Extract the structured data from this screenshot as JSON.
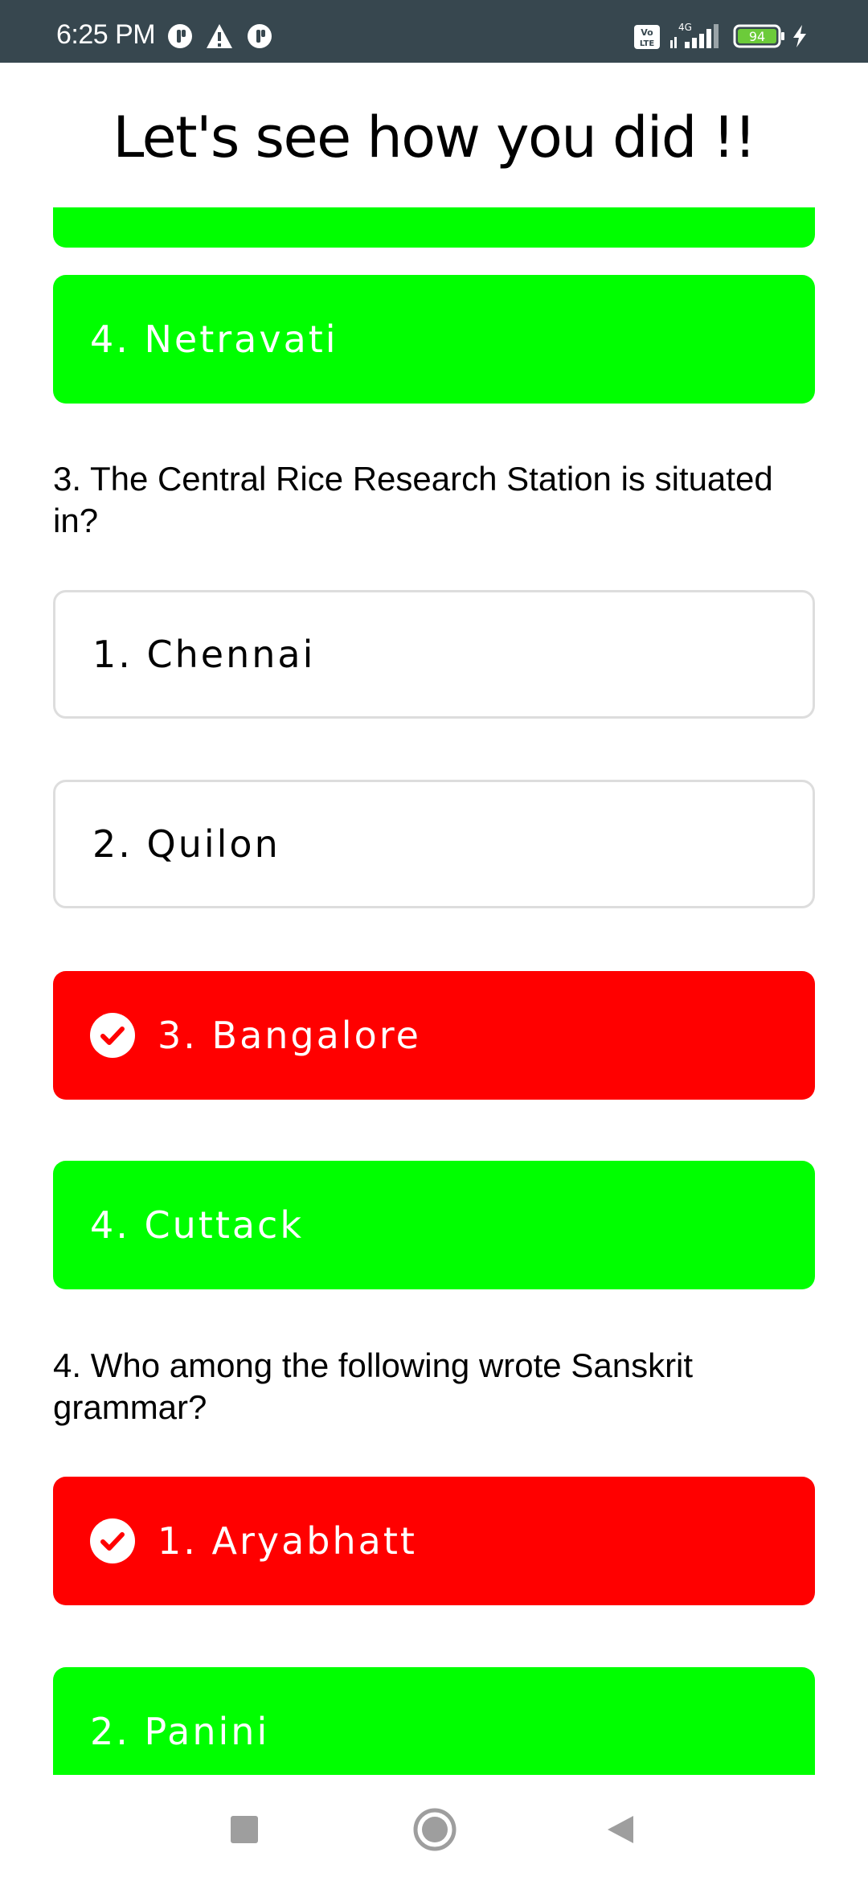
{
  "status_bar": {
    "time": "6:25 PM",
    "battery": "94",
    "network": "4G",
    "volte": "Vo LTE",
    "icons": [
      "sync-icon",
      "warning-icon",
      "sync-icon",
      "volte-icon",
      "signal-icon",
      "battery-icon",
      "charging-icon"
    ]
  },
  "header": {
    "title": "Let's see how you did !!"
  },
  "quiz": {
    "q2": {
      "options": [
        {
          "label": "4. Netravati",
          "state": "correct"
        }
      ]
    },
    "q3": {
      "question": "3. The Central Rice Research Station is situated in?",
      "options": [
        {
          "label": "1. Chennai",
          "state": "none"
        },
        {
          "label": "2. Quilon",
          "state": "none"
        },
        {
          "label": "3. Bangalore",
          "state": "selected-wrong"
        },
        {
          "label": "4. Cuttack",
          "state": "correct"
        }
      ]
    },
    "q4": {
      "question": "4. Who among the following wrote Sanskrit grammar?",
      "options": [
        {
          "label": "1. Aryabhatt",
          "state": "selected-wrong"
        },
        {
          "label": "2. Panini",
          "state": "correct"
        }
      ]
    }
  },
  "colors": {
    "correct": "#00ff00",
    "wrong": "#ff0000",
    "status_bar": "#37474f"
  },
  "nav": {
    "icons": [
      "recents-square-icon",
      "home-circle-icon",
      "back-triangle-icon"
    ]
  }
}
